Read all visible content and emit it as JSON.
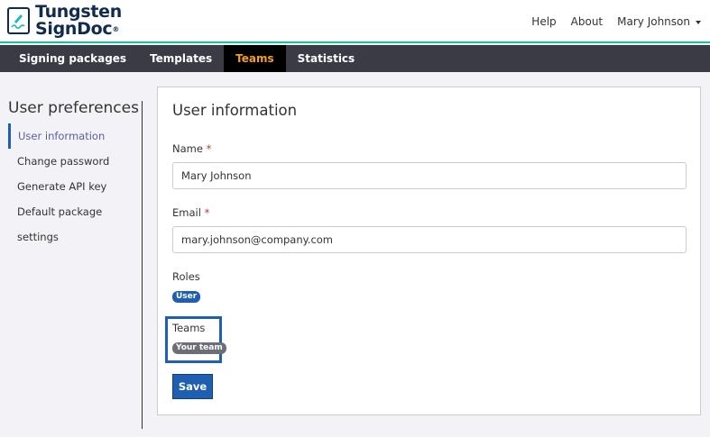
{
  "brand": {
    "line1": "Tungsten",
    "line2": "SignDoc",
    "reg": "®"
  },
  "topnav": {
    "help": "Help",
    "about": "About",
    "user": "Mary Johnson"
  },
  "nav": [
    "Signing packages",
    "Templates",
    "Teams",
    "Statistics"
  ],
  "sidebar": {
    "title": "User preferences",
    "items": [
      "User information",
      "Change password",
      "Generate API key",
      "Default package settings"
    ]
  },
  "form": {
    "title": "User information",
    "name_label": "Name",
    "name_value": "Mary Johnson",
    "email_label": "Email",
    "email_value": "mary.johnson@company.com",
    "required": "*",
    "roles_label": "Roles",
    "role_badge": "User",
    "teams_label": "Teams",
    "team_badge": "Your team",
    "save": "Save"
  },
  "colors": {
    "accent": "#1e5fb3",
    "active_nav": "#f5a01a",
    "navbar": "#3a3b44"
  }
}
